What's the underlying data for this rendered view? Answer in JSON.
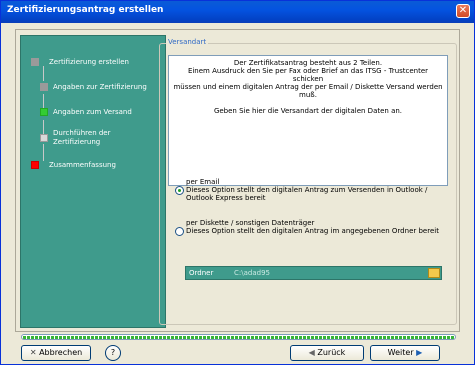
{
  "window": {
    "title": "Zertifizierungsantrag erstellen",
    "close_glyph": "✕"
  },
  "sidebar": {
    "items": [
      {
        "label": "Zertifizierung erstellen",
        "status": "done",
        "color": "#9a9a9a"
      },
      {
        "label": "Angaben zur Zertifizierung",
        "status": "done",
        "color": "#9a9a9a"
      },
      {
        "label": "Angaben zum Versand",
        "status": "current",
        "color": "#33cc33"
      },
      {
        "label": "Durchführen der Zertifizierung",
        "status": "pending",
        "color": "#d9d9d9"
      },
      {
        "label": "Zusammenfassung",
        "status": "error",
        "color": "#ff0000"
      }
    ]
  },
  "group": {
    "legend": "Versandart"
  },
  "info": {
    "line1": "Der Zertifikatsantrag besteht aus 2 Teilen.",
    "line2": "Einem Ausdruck den Sie per Fax oder Brief an das ITSG - Trustcenter schicken",
    "line3": "müssen und einem digitalen Antrag der per Email / Diskette Versand werden muß.",
    "line4": "Geben Sie hier die Versandart der digitalen Daten an."
  },
  "options": [
    {
      "title": "per Email",
      "desc": "Dieses Option stellt den digitalen Antrag zum Versenden in Outlook / Outlook Express bereit",
      "selected": true
    },
    {
      "title": "per Diskette / sonstigen Datenträger",
      "desc": "Dieses Option stellt den digitalen Antrag im angegebenen Ordner bereit",
      "selected": false
    }
  ],
  "folder": {
    "label": "Ordner",
    "value": "C:\\adad95"
  },
  "progress": {
    "fraction": 1.0
  },
  "buttons": {
    "cancel": "Abbrechen",
    "help_glyph": "?",
    "back": "Zurück",
    "next": "Weiter"
  },
  "colors": {
    "accent": "#3f9b8c",
    "title_bar": "#0453e0"
  }
}
